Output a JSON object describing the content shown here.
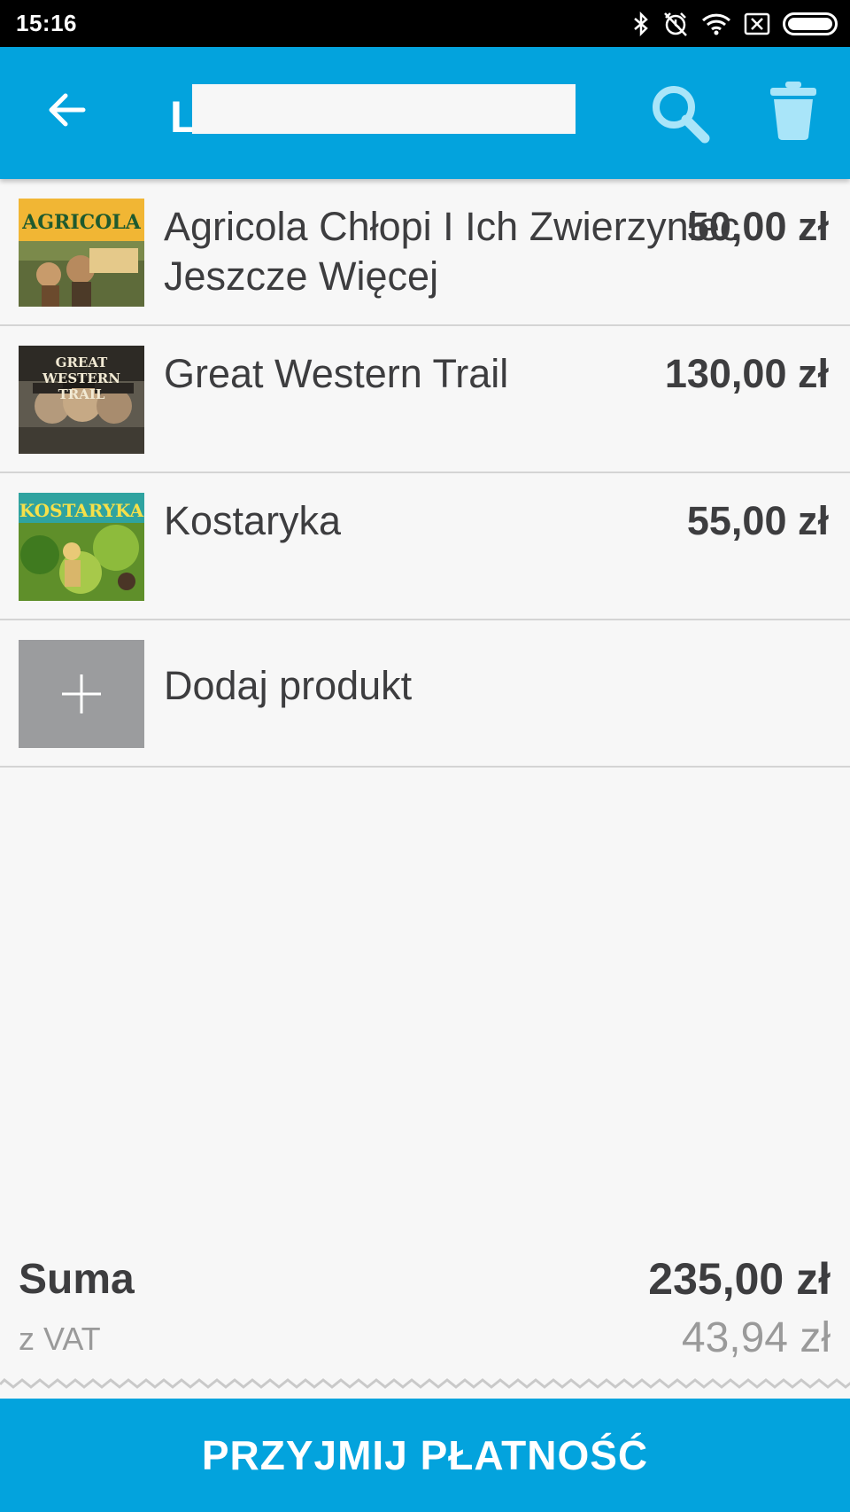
{
  "status_bar": {
    "time": "15:16",
    "icons": [
      "bluetooth-icon",
      "alarm-off-icon",
      "wifi-icon",
      "no-sim-icon",
      "battery-icon"
    ]
  },
  "app_bar": {
    "title": "L...",
    "back_icon": "arrow-left-icon",
    "search_icon": "search-icon",
    "delete_icon": "trash-icon",
    "color": "#03a3dd"
  },
  "products": [
    {
      "name": "Agricola Chłopi I Ich Zwierzyniec Jeszcze Więcej",
      "price": "50,00 zł",
      "thumbnail_title": "AGRICOLA",
      "thumb_color": "#f1b634"
    },
    {
      "name": "Great Western Trail",
      "price": "130,00 zł",
      "thumbnail_title": "GREAT WESTERN TRAIL",
      "thumb_color": "#6e6a5e"
    },
    {
      "name": "Kostaryka",
      "price": "55,00 zł",
      "thumbnail_title": "KOSTARYKA",
      "thumb_color": "#7fa83a"
    }
  ],
  "add_product": {
    "label": "Dodaj produkt",
    "icon": "plus-icon"
  },
  "totals": {
    "sum_label": "Suma",
    "sum_value": "235,00 zł",
    "vat_label": "z VAT",
    "vat_value": "43,94 zł"
  },
  "pay_button": {
    "label": "PRZYJMIJ PŁATNOŚĆ"
  }
}
